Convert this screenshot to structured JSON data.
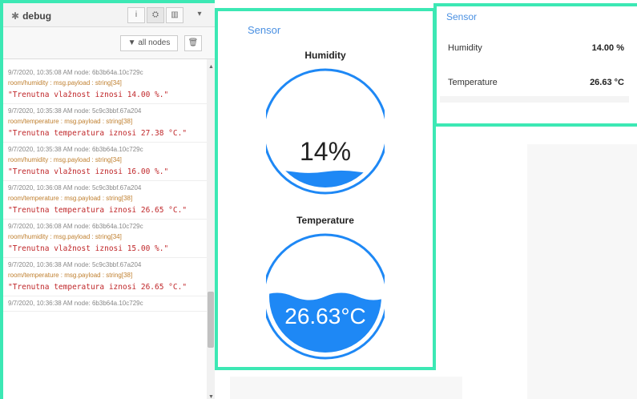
{
  "debug": {
    "icon": "bug-icon",
    "title": "debug",
    "header_buttons": [
      "i",
      "⛭",
      "▥"
    ],
    "dropdown": "▾",
    "filter_label": "▼ all nodes",
    "trash": "🗑",
    "messages": [
      {
        "meta": "9/7/2020, 10:35:08 AM   node: 6b3b64a.10c729c",
        "topic": "room/humidity : msg.payload : string[34]",
        "payload": "\"Trenutna vlažnost iznosi  14.00 %.\""
      },
      {
        "meta": "9/7/2020, 10:35:38 AM   node: 5c9c3bbf.67a204",
        "topic": "room/temperature : msg.payload : string[38]",
        "payload": "\"Trenutna temperatura iznosi  27.38 °C.\""
      },
      {
        "meta": "9/7/2020, 10:35:38 AM   node: 6b3b64a.10c729c",
        "topic": "room/humidity : msg.payload : string[34]",
        "payload": "\"Trenutna vlažnost iznosi  16.00 %.\""
      },
      {
        "meta": "9/7/2020, 10:36:08 AM   node: 5c9c3bbf.67a204",
        "topic": "room/temperature : msg.payload : string[38]",
        "payload": "\"Trenutna temperatura iznosi  26.65 °C.\""
      },
      {
        "meta": "9/7/2020, 10:36:08 AM   node: 6b3b64a.10c729c",
        "topic": "room/humidity : msg.payload : string[34]",
        "payload": "\"Trenutna vlažnost iznosi  15.00 %.\""
      },
      {
        "meta": "9/7/2020, 10:36:38 AM   node: 5c9c3bbf.67a204",
        "topic": "room/temperature : msg.payload : string[38]",
        "payload": "\"Trenutna temperatura iznosi  26.65 °C.\""
      },
      {
        "meta": "9/7/2020, 10:36:38 AM   node: 6b3b64a.10c729c",
        "topic": "",
        "payload": ""
      }
    ]
  },
  "sensor_gauges": {
    "title": "Sensor",
    "humidity": {
      "label": "Humidity",
      "display": "14%",
      "level": 0.14
    },
    "temperature": {
      "label": "Temperature",
      "display": "26.63°C",
      "level": 0.5
    }
  },
  "sensor_text": {
    "title": "Sensor",
    "rows": [
      {
        "label": "Humidity",
        "value": "14.00 %"
      },
      {
        "label": "Temperature",
        "value": "26.63 °C"
      }
    ]
  },
  "colors": {
    "accent_border": "#3ce8b4",
    "liquid": "#1e88f5",
    "title_blue": "#4a90e2",
    "payload_red": "#c0282b"
  }
}
